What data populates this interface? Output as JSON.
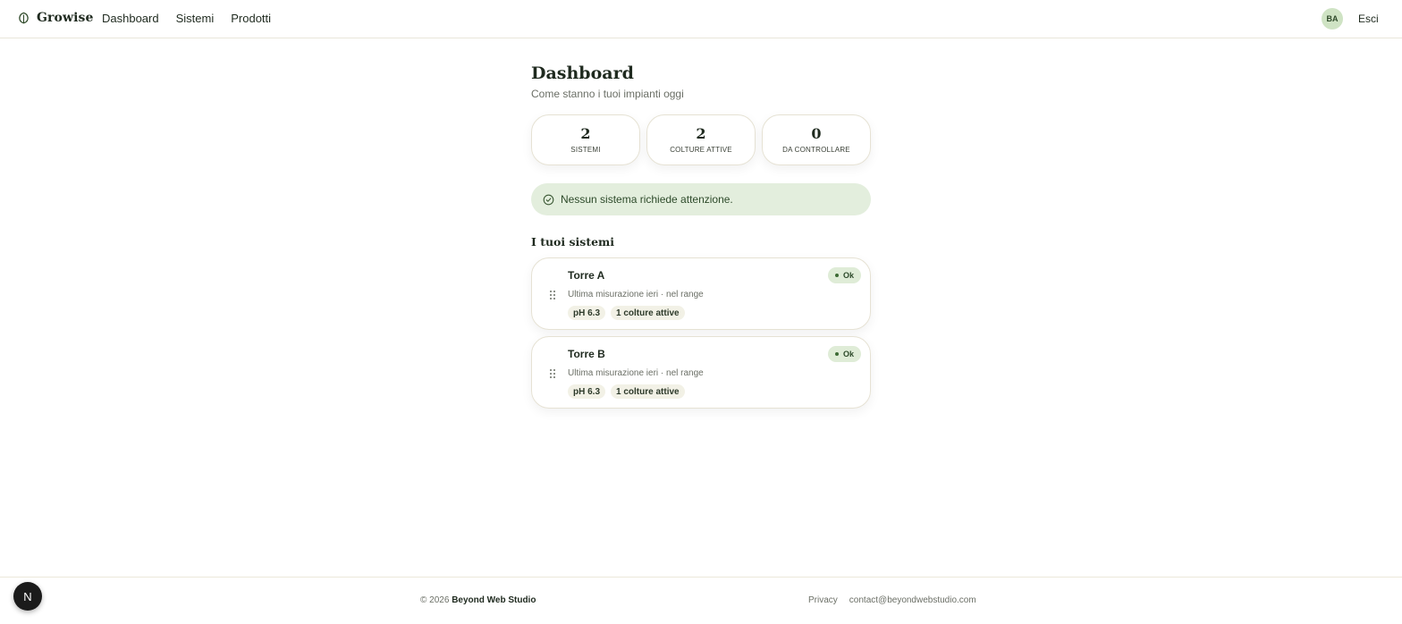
{
  "header": {
    "brand": "Growise",
    "nav": [
      "Dashboard",
      "Sistemi",
      "Prodotti"
    ],
    "avatar_initials": "BA",
    "logout_label": "Esci",
    "icons": {
      "brand": "leaf-icon"
    }
  },
  "main": {
    "title": "Dashboard",
    "subtitle": "Come stanno i tuoi impianti oggi",
    "stats": [
      {
        "value": "2",
        "label": "SISTEMI"
      },
      {
        "value": "2",
        "label": "COLTURE ATTIVE"
      },
      {
        "value": "0",
        "label": "DA CONTROLLARE"
      }
    ],
    "alert": {
      "text": "Nessun sistema richiede attenzione.",
      "icon": "check-circle-icon"
    },
    "systems_title": "I tuoi sistemi",
    "systems": [
      {
        "name": "Torre A",
        "meta": "Ultima misurazione ieri · nel range",
        "tags": [
          "pH 6.3",
          "1 colture attive"
        ],
        "status": "Ok"
      },
      {
        "name": "Torre B",
        "meta": "Ultima misurazione ieri · nel range",
        "tags": [
          "pH 6.3",
          "1 colture attive"
        ],
        "status": "Ok"
      }
    ]
  },
  "footer": {
    "copyright_prefix": "© 2026",
    "company": "Beyond Web Studio",
    "links": [
      "Privacy",
      "contact@beyondwebstudio.com"
    ]
  },
  "dev_badge": {
    "label": "N"
  },
  "colors": {
    "accent": "#dfecd7",
    "alert_bg": "#e3eedd",
    "avatar_bg": "#cfe3c4",
    "text": "#1f2a1f"
  }
}
